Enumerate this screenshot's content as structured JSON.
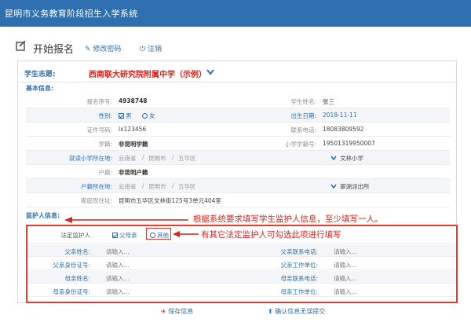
{
  "app": {
    "title": "昆明市义务教育阶段招生入学系统"
  },
  "header": {
    "title": "开始报名",
    "links": [
      {
        "label": "修改密码",
        "icon": "edit-icon"
      },
      {
        "label": "注销",
        "icon": "power-icon"
      }
    ]
  },
  "choice": {
    "label": "学生志愿:",
    "value": "西南联大研究院附属中学（示例）"
  },
  "basic": {
    "section_label": "基本信息:",
    "fields": {
      "reg_no_label": "报名序号:",
      "reg_no": "4938748",
      "name_label": "学生姓名:",
      "name": "张三",
      "gender_label": "性别:",
      "gender_male": "男",
      "gender_female": "女",
      "birth_label": "出生日期:",
      "birth": "2018-11-11",
      "id_label": "证件号码:",
      "id_value": "lx123456",
      "phone_label": "联系电话:",
      "phone": "18083809592",
      "status_label": "学籍:",
      "status": "非昆明学籍",
      "school_no_label": "小学学籍号:",
      "school_no": "19501319950007",
      "primary_place_label": "就读小学所在地:",
      "primary_prov": "云南省",
      "primary_city": "昆明市",
      "primary_dist": "五华区",
      "primary_school": "文林小学",
      "hukou_label": "户籍:",
      "hukou": "非昆明户籍",
      "hukou_place_label": "户籍所在地:",
      "hukou_prov": "云南省",
      "hukou_city": "昆明市",
      "hukou_dist": "五华区",
      "hukou_station": "翠湖派出所",
      "address_label": "家庭现住址:",
      "address": "昆明市五华区文林街125号3单元404室"
    }
  },
  "guardian": {
    "section_label": "监护人信息:",
    "legal_label": "法定监护人",
    "opt_parents": "父母亲",
    "opt_other": "其他",
    "father_name_label": "父亲姓名:",
    "father_name_ph": "请输入...",
    "father_phone_label": "父亲联系电话:",
    "father_phone_ph": "请输入...",
    "father_id_label": "父亲身份证号:",
    "father_id_ph": "请输入...",
    "father_work_label": "父亲工作单位:",
    "father_work_ph": "请输入...",
    "mother_name_label": "母亲姓名:",
    "mother_name_ph": "请输入...",
    "mother_phone_label": "母亲联系电话:",
    "mother_phone_ph": "请输入...",
    "mother_id_label": "母亲身份证号:",
    "mother_id_ph": "请输入...",
    "mother_work_label": "母亲工作单位:",
    "mother_work_ph": "请输入..."
  },
  "annotations": {
    "note1": "根据系统要求填写学生监护人信息，至少填写一人。",
    "note2": "有其它法定监护人可勾选此项进行填写"
  },
  "footer": {
    "save": "保存信息",
    "confirm": "确认信息无误提交"
  },
  "colors": {
    "brand": "#2e6fb0",
    "accent_red": "#d9241c"
  }
}
